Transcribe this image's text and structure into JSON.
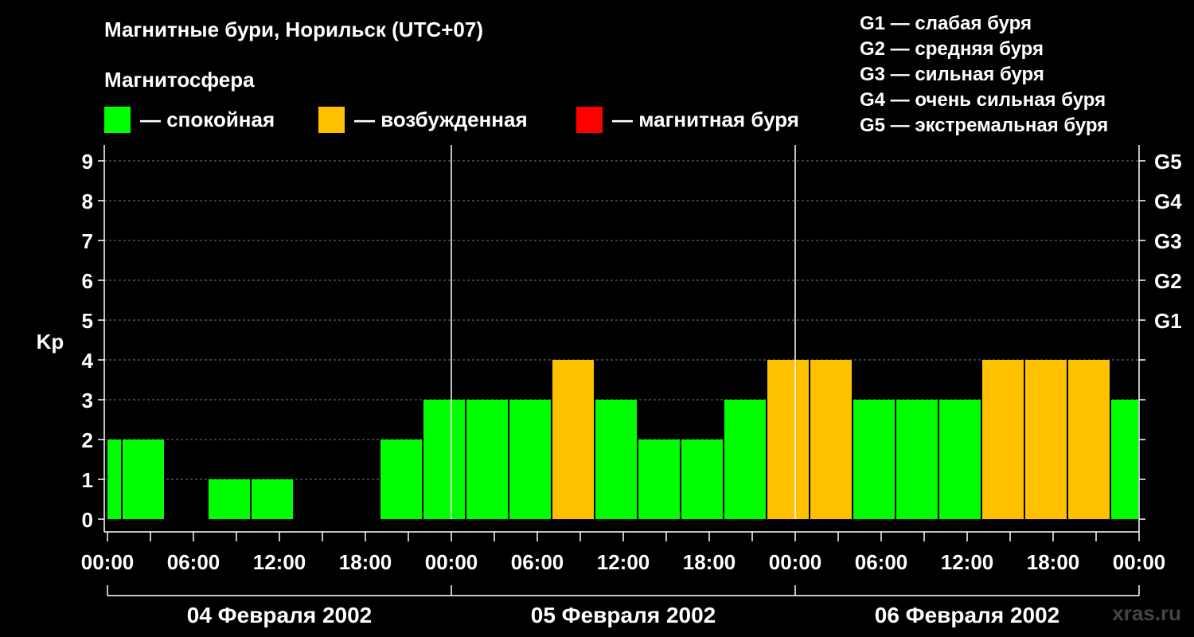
{
  "title": "Магнитные бури, Норильск (UTC+07)",
  "legend": {
    "title": "Магнитосфера",
    "items": [
      {
        "label": "— спокойная",
        "color": "#00ff00"
      },
      {
        "label": "— возбужденная",
        "color": "#ffc000"
      },
      {
        "label": "— магнитная буря",
        "color": "#ff0000"
      }
    ]
  },
  "storm_levels": [
    "G1 — слабая буря",
    "G2 — средняя буря",
    "G3 — сильная буря",
    "G4 — очень сильная буря",
    "G5 — экстремальная буря"
  ],
  "watermark": "xras.ru",
  "chart_data": {
    "type": "bar",
    "ylabel": "Kp",
    "ylim": [
      0,
      9
    ],
    "yticks": [
      0,
      1,
      2,
      3,
      4,
      5,
      6,
      7,
      8,
      9
    ],
    "right_axis_labels": [
      {
        "kp": 5,
        "label": "G1"
      },
      {
        "kp": 6,
        "label": "G2"
      },
      {
        "kp": 7,
        "label": "G3"
      },
      {
        "kp": 8,
        "label": "G4"
      },
      {
        "kp": 9,
        "label": "G5"
      }
    ],
    "x_range_hours": [
      0,
      72
    ],
    "x_tick_labels": [
      "00:00",
      "06:00",
      "12:00",
      "18:00",
      "00:00",
      "06:00",
      "12:00",
      "18:00",
      "00:00",
      "06:00",
      "12:00",
      "18:00",
      "00:00"
    ],
    "days": [
      "04 Февраля 2002",
      "05 Февраля 2002",
      "06 Февраля 2002"
    ],
    "bars": [
      {
        "start": 0,
        "end": 1,
        "kp": 2,
        "level": "quiet"
      },
      {
        "start": 1,
        "end": 4,
        "kp": 2,
        "level": "quiet"
      },
      {
        "start": 4,
        "end": 7,
        "kp": 0,
        "level": "quiet"
      },
      {
        "start": 7,
        "end": 10,
        "kp": 1,
        "level": "quiet"
      },
      {
        "start": 10,
        "end": 13,
        "kp": 1,
        "level": "quiet"
      },
      {
        "start": 13,
        "end": 16,
        "kp": 0,
        "level": "quiet"
      },
      {
        "start": 16,
        "end": 19,
        "kp": 0,
        "level": "quiet"
      },
      {
        "start": 19,
        "end": 22,
        "kp": 2,
        "level": "quiet"
      },
      {
        "start": 22,
        "end": 25,
        "kp": 3,
        "level": "quiet"
      },
      {
        "start": 25,
        "end": 28,
        "kp": 3,
        "level": "quiet"
      },
      {
        "start": 28,
        "end": 31,
        "kp": 3,
        "level": "quiet"
      },
      {
        "start": 31,
        "end": 34,
        "kp": 4,
        "level": "active"
      },
      {
        "start": 34,
        "end": 37,
        "kp": 3,
        "level": "quiet"
      },
      {
        "start": 37,
        "end": 40,
        "kp": 2,
        "level": "quiet"
      },
      {
        "start": 40,
        "end": 43,
        "kp": 2,
        "level": "quiet"
      },
      {
        "start": 43,
        "end": 46,
        "kp": 3,
        "level": "quiet"
      },
      {
        "start": 46,
        "end": 49,
        "kp": 4,
        "level": "active"
      },
      {
        "start": 49,
        "end": 52,
        "kp": 4,
        "level": "active"
      },
      {
        "start": 52,
        "end": 55,
        "kp": 3,
        "level": "quiet"
      },
      {
        "start": 55,
        "end": 58,
        "kp": 3,
        "level": "quiet"
      },
      {
        "start": 58,
        "end": 61,
        "kp": 3,
        "level": "quiet"
      },
      {
        "start": 61,
        "end": 64,
        "kp": 4,
        "level": "active"
      },
      {
        "start": 64,
        "end": 67,
        "kp": 4,
        "level": "active"
      },
      {
        "start": 67,
        "end": 70,
        "kp": 4,
        "level": "active"
      },
      {
        "start": 70,
        "end": 72,
        "kp": 3,
        "level": "quiet"
      }
    ],
    "colors": {
      "quiet": "#00ff00",
      "active": "#ffc000",
      "storm": "#ff0000"
    }
  }
}
